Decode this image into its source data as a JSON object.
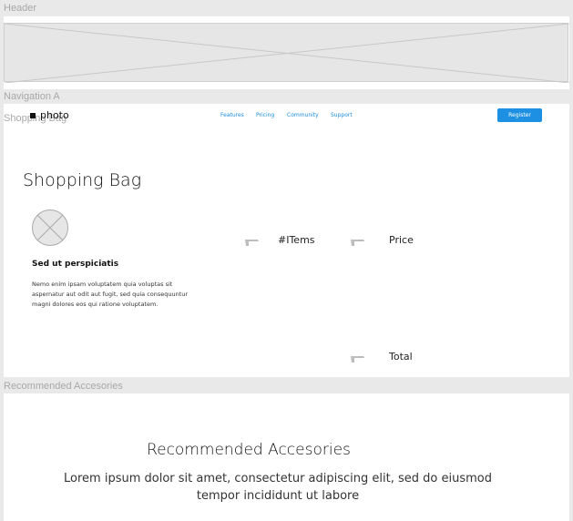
{
  "frames": {
    "header_label": "Header",
    "navigation_label": "Navigation A",
    "shopping_bag_label": "Shopping Bag",
    "recommended_label": "Recommended Accesories"
  },
  "nav": {
    "logo_text": "photo",
    "links": [
      "Features",
      "Pricing",
      "Community",
      "Support"
    ],
    "register_label": "Register"
  },
  "bag": {
    "title": "Shopping Bag",
    "items_header": "#ITems",
    "price_header": "Price",
    "total_label": "Total",
    "product": {
      "title": "Sed ut perspiciatis",
      "description": "Nemo enim ipsam voluptatem quia voluptas sit aspernatur aut odit aut fugit, sed quia consequuntur magni dolores eos qui ratione voluptatem."
    }
  },
  "recommended": {
    "title": "Recommended Accesories",
    "subtitle": "Lorem ipsum dolor sit amet, consectetur adipiscing elit, sed do eiusmod tempor incididunt ut labore"
  },
  "colors": {
    "accent": "#1e90e4",
    "link": "#1c8ddb",
    "canvas": "#e9e9e9"
  }
}
